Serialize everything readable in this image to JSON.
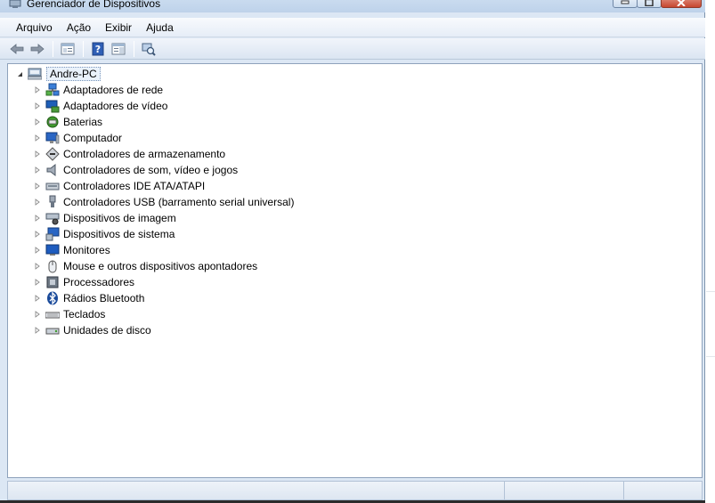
{
  "window": {
    "title": "Gerenciador de Dispositivos"
  },
  "menu": [
    "Arquivo",
    "Ação",
    "Exibir",
    "Ajuda"
  ],
  "toolbar": {
    "buttons": [
      "back-arrow-icon",
      "forward-arrow-icon",
      "properties-console-icon",
      "help-icon",
      "show-hide-pane-icon",
      "scan-hardware-icon"
    ]
  },
  "tree": {
    "root": "Andre-PC",
    "items": [
      {
        "label": "Adaptadores de rede",
        "icon": "network-adapter-icon"
      },
      {
        "label": "Adaptadores de vídeo",
        "icon": "display-adapter-icon"
      },
      {
        "label": "Baterias",
        "icon": "battery-icon"
      },
      {
        "label": "Computador",
        "icon": "computer-icon"
      },
      {
        "label": "Controladores de armazenamento",
        "icon": "storage-controller-icon"
      },
      {
        "label": "Controladores de som, vídeo e jogos",
        "icon": "sound-icon"
      },
      {
        "label": "Controladores IDE ATA/ATAPI",
        "icon": "ide-controller-icon"
      },
      {
        "label": "Controladores USB (barramento serial universal)",
        "icon": "usb-icon"
      },
      {
        "label": "Dispositivos de imagem",
        "icon": "camera-icon"
      },
      {
        "label": "Dispositivos de sistema",
        "icon": "system-device-icon"
      },
      {
        "label": "Monitores",
        "icon": "monitor-icon"
      },
      {
        "label": "Mouse e outros dispositivos apontadores",
        "icon": "mouse-icon"
      },
      {
        "label": "Processadores",
        "icon": "processor-icon"
      },
      {
        "label": "Rádios Bluetooth",
        "icon": "bluetooth-icon"
      },
      {
        "label": "Teclados",
        "icon": "keyboard-icon"
      },
      {
        "label": "Unidades de disco",
        "icon": "disk-drive-icon"
      }
    ]
  },
  "colors": {
    "window_frame": "#dce7f4",
    "selection_border": "#7a96bb",
    "close_button": "#c7462f"
  }
}
